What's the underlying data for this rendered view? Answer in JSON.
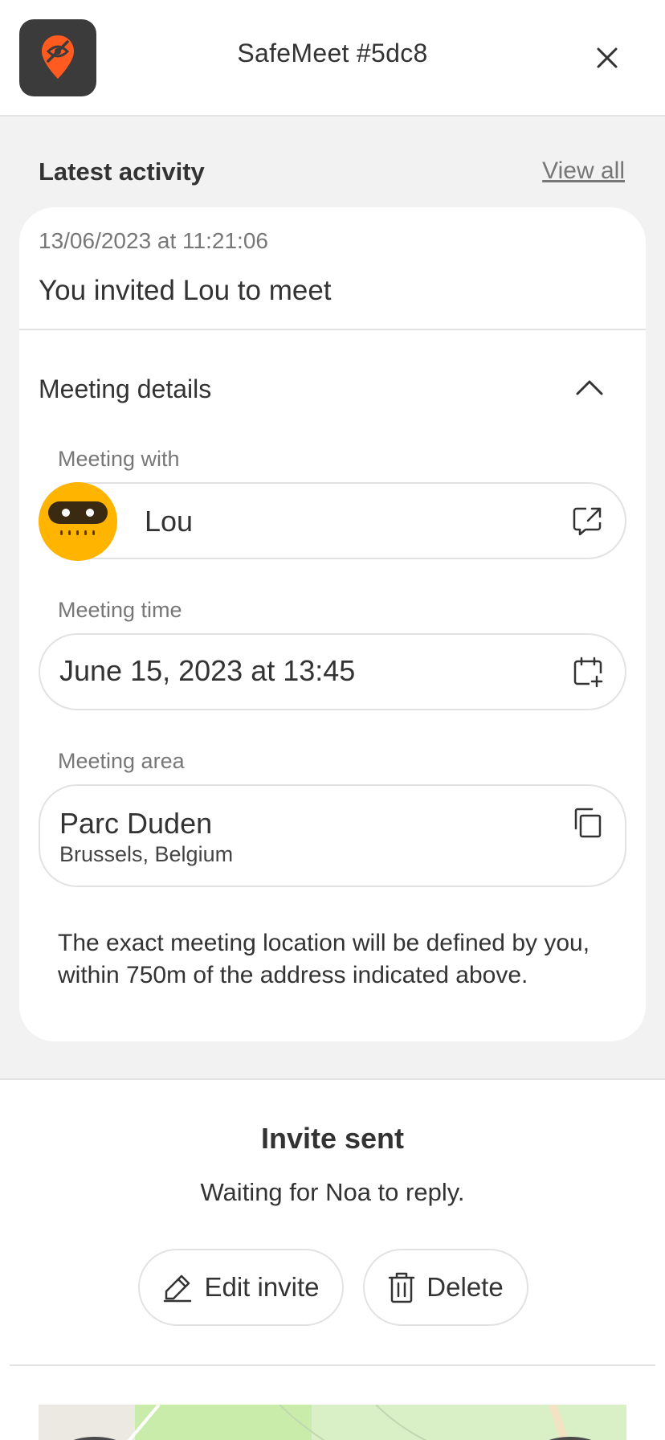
{
  "header": {
    "title": "SafeMeet #5dc8"
  },
  "activity": {
    "heading": "Latest activity",
    "view_all": "View all",
    "timestamp": "13/06/2023 at 11:21:06",
    "message": "You invited Lou to meet"
  },
  "details": {
    "title": "Meeting details",
    "with_label": "Meeting with",
    "with_name": "Lou",
    "time_label": "Meeting time",
    "time_value": "June 15, 2023 at 13:45",
    "area_label": "Meeting area",
    "area_name": "Parc Duden",
    "area_city": "Brussels, Belgium",
    "note": "The exact meeting location will be defined by you, within 750m of the address indicated above."
  },
  "status": {
    "title": "Invite sent",
    "subtitle": "Waiting for Noa to reply.",
    "edit_label": "Edit invite",
    "delete_label": "Delete"
  },
  "colors": {
    "accent": "#ff5a1f",
    "avatar": "#ffb400",
    "logo_bg": "#3b3b3b"
  },
  "icons": [
    "location-hidden-icon",
    "close-icon",
    "chevron-up-icon",
    "open-chat-icon",
    "calendar-add-icon",
    "copy-icon",
    "pencil-icon",
    "trash-icon"
  ]
}
